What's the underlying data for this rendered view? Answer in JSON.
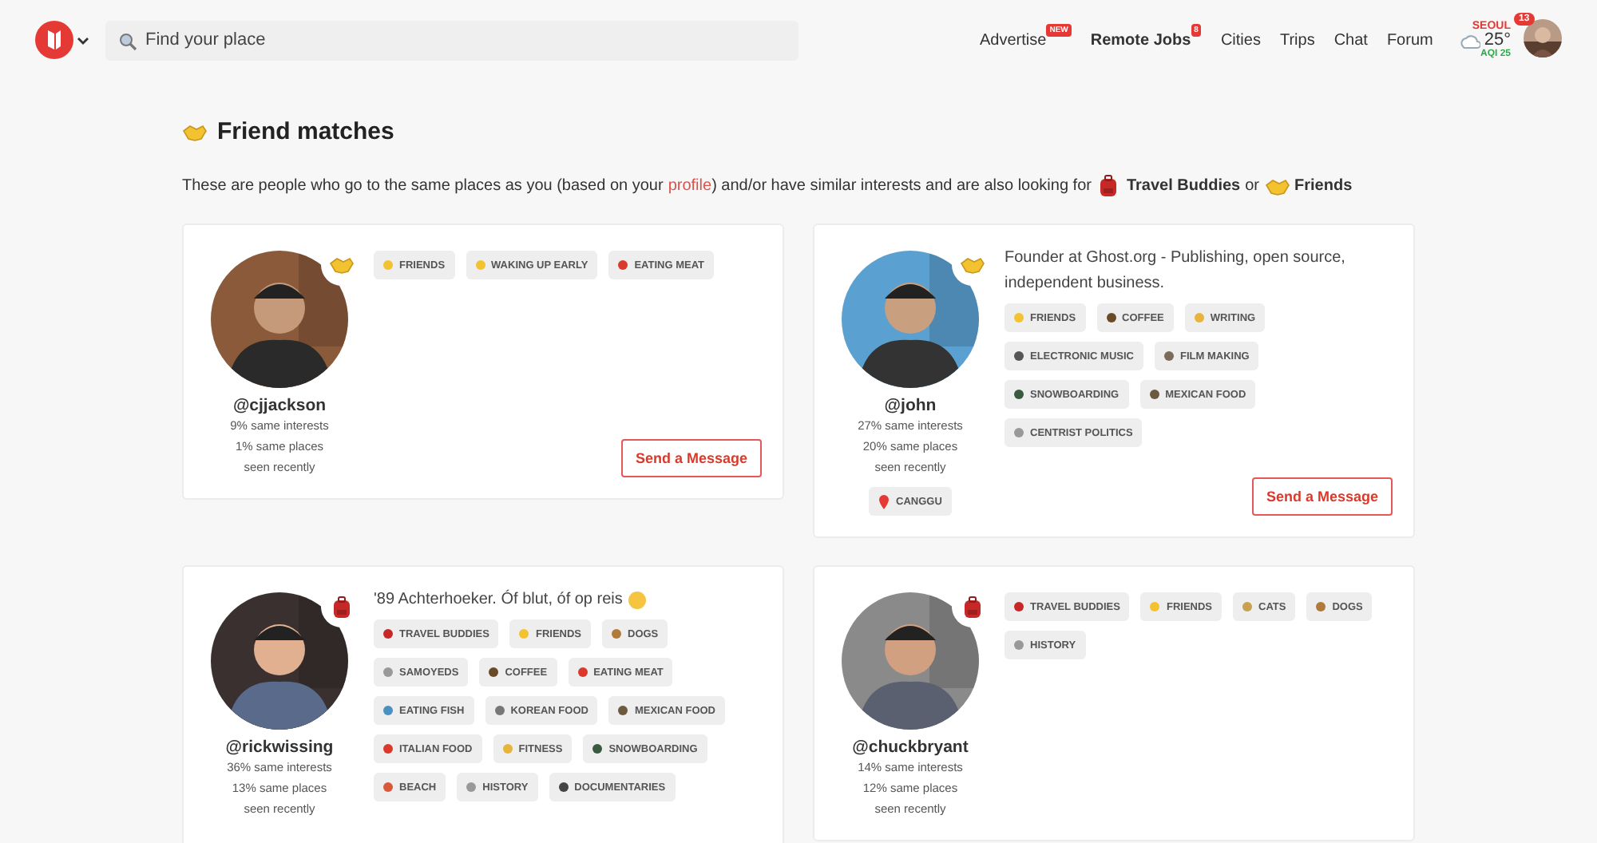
{
  "header": {
    "search": {
      "placeholder": "Find your place"
    },
    "nav": [
      {
        "label": "Advertise",
        "bold": false,
        "badge": "NEW"
      },
      {
        "label": "Remote Jobs",
        "bold": true,
        "badge": "8"
      },
      {
        "label": "Cities",
        "bold": false
      },
      {
        "label": "Trips",
        "bold": false
      },
      {
        "label": "Chat",
        "bold": false
      },
      {
        "label": "Forum",
        "bold": false
      }
    ],
    "weather": {
      "city": "SEOUL",
      "temperature": "25°",
      "aqi": "AQI 25"
    },
    "notifications": "13"
  },
  "intro": {
    "title": "Friend matches",
    "before": "These are people who go to the same places as you (based on your",
    "link": "profile",
    "after": ") and/or have similar interests and are also looking for",
    "looking_for": [
      {
        "kind": "travel",
        "label": "Travel Buddies"
      },
      {
        "kind": "friends",
        "label": "Friends"
      }
    ],
    "joiner": "or"
  },
  "cards": [
    {
      "username": "@cjjackson",
      "kind": "friends",
      "stats": [
        "9% same interests",
        "1% same places",
        "seen recently"
      ],
      "tags": [
        {
          "label": "FRIENDS",
          "color": "#f2c230"
        },
        {
          "label": "WAKING UP EARLY",
          "color": "#f2c230"
        },
        {
          "label": "EATING MEAT",
          "color": "#d93a2b"
        }
      ],
      "button": "Send a Message"
    },
    {
      "username": "@john",
      "kind": "friends",
      "bio": "Founder at Ghost.org - Publishing, open source, independent business.",
      "stats": [
        "27% same interests",
        "20% same places",
        "seen recently"
      ],
      "location": "CANGGU",
      "tags": [
        {
          "label": "FRIENDS",
          "color": "#f2c230"
        },
        {
          "label": "COFFEE",
          "color": "#6b4a2a"
        },
        {
          "label": "WRITING",
          "color": "#e7b33a"
        },
        {
          "label": "ELECTRONIC MUSIC",
          "color": "#555555"
        },
        {
          "label": "FILM MAKING",
          "color": "#7a6b5a"
        },
        {
          "label": "SNOWBOARDING",
          "color": "#3a5a40"
        },
        {
          "label": "MEXICAN FOOD",
          "color": "#6b5a40"
        },
        {
          "label": "CENTRIST POLITICS",
          "color": "#999999"
        }
      ],
      "button": "Send a Message"
    },
    {
      "username": "@rickwissing",
      "kind": "travel",
      "bio": "'89 Achterhoeker. Óf blut, óf op reis",
      "bio_emoji": true,
      "stats": [
        "36% same interests",
        "13% same places",
        "seen recently"
      ],
      "tags": [
        {
          "label": "TRAVEL BUDDIES",
          "color": "#c62828"
        },
        {
          "label": "FRIENDS",
          "color": "#f2c230"
        },
        {
          "label": "DOGS",
          "color": "#b07a3a"
        },
        {
          "label": "SAMOYEDS",
          "color": "#999999"
        },
        {
          "label": "COFFEE",
          "color": "#6b4a2a"
        },
        {
          "label": "EATING MEAT",
          "color": "#d93a2b"
        },
        {
          "label": "EATING FISH",
          "color": "#4a90c0"
        },
        {
          "label": "KOREAN FOOD",
          "color": "#777777"
        },
        {
          "label": "MEXICAN FOOD",
          "color": "#6b5a40"
        },
        {
          "label": "ITALIAN FOOD",
          "color": "#d93a2b"
        },
        {
          "label": "FITNESS",
          "color": "#e7b33a"
        },
        {
          "label": "SNOWBOARDING",
          "color": "#3a5a40"
        },
        {
          "label": "BEACH",
          "color": "#d9583a"
        },
        {
          "label": "HISTORY",
          "color": "#999999"
        },
        {
          "label": "DOCUMENTARIES",
          "color": "#444444"
        }
      ]
    },
    {
      "username": "@chuckbryant",
      "kind": "travel",
      "stats": [
        "14% same interests",
        "12% same places",
        "seen recently"
      ],
      "tags": [
        {
          "label": "TRAVEL BUDDIES",
          "color": "#c62828"
        },
        {
          "label": "FRIENDS",
          "color": "#f2c230"
        },
        {
          "label": "CATS",
          "color": "#c8a050"
        },
        {
          "label": "DOGS",
          "color": "#b07a3a"
        },
        {
          "label": "HISTORY",
          "color": "#999999"
        }
      ]
    }
  ]
}
